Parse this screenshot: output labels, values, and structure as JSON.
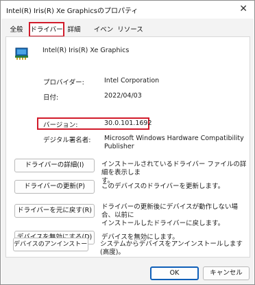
{
  "window": {
    "title": "Intel(R) Iris(R) Xe Graphicsのプロパティ",
    "close_glyph": "✕"
  },
  "tabs": [
    {
      "label": "全般"
    },
    {
      "label": "ドライバー"
    },
    {
      "label": "詳細"
    },
    {
      "label": "イベント"
    },
    {
      "label": "リソース"
    }
  ],
  "device": {
    "name": "Intel(R) Iris(R) Xe Graphics",
    "icon": "display-adapter-icon"
  },
  "info": {
    "provider_label": "プロバイダー:",
    "provider_value": "Intel Corporation",
    "date_label": "日付:",
    "date_value": "2022/04/03",
    "version_label": "バージョン:",
    "version_value": "30.0.101.1692",
    "signer_label": "デジタル署名者:",
    "signer_value_1": "Microsoft Windows Hardware Compatibility",
    "signer_value_2": "Publisher"
  },
  "actions": [
    {
      "label": "ドライバーの詳細(I)",
      "desc_1": "インストールされているドライバー ファイルの詳細を表示しま",
      "desc_2": "す。"
    },
    {
      "label": "ドライバーの更新(P)",
      "desc_1": "このデバイスのドライバーを更新します。",
      "desc_2": ""
    },
    {
      "label": "ドライバーを元に戻す(R)",
      "desc_1": "ドライバーの更新後にデバイスが動作しない場合、以前に",
      "desc_2": "インストールしたドライバーに戻します。"
    },
    {
      "label": "デバイスを無効にする(D)",
      "desc_1": "デバイスを無効にします。",
      "desc_2": ""
    },
    {
      "label": "デバイスのアンインストール(U)",
      "desc_1": "システムからデバイスをアンインストールします (高度)。",
      "desc_2": ""
    }
  ],
  "footer": {
    "ok_label": "OK",
    "cancel_label": "キャンセル"
  },
  "colors": {
    "highlight": "#d11a2a",
    "focus": "#0f5fb8"
  }
}
